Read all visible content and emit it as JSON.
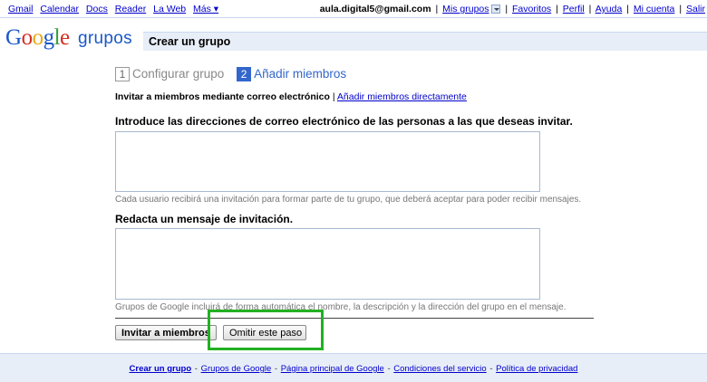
{
  "topbar": {
    "nav": [
      "Gmail",
      "Calendar",
      "Docs",
      "Reader",
      "La Web",
      "Más ▾"
    ],
    "email": "aula.digital5@gmail.com",
    "mis_grupos": "Mis grupos",
    "links": [
      "Favoritos",
      "Perfil",
      "Ayuda",
      "Mi cuenta",
      "Salir"
    ],
    "sep": "|"
  },
  "logo": {
    "letters": [
      "G",
      "o",
      "o",
      "g",
      "l",
      "e"
    ],
    "product": "grupos"
  },
  "page_title": "Crear un grupo",
  "steps": [
    {
      "num": "1",
      "label": "Configurar grupo"
    },
    {
      "num": "2",
      "label": "Añadir miembros"
    }
  ],
  "invite_mode": {
    "current": "Invitar a miembros mediante correo electrónico",
    "sep": "|",
    "alt_link": "Añadir miembros directamente"
  },
  "emails_section": {
    "label": "Introduce las direcciones de correo electrónico de las personas a las que deseas invitar.",
    "value": "",
    "hint": "Cada usuario recibirá una invitación para formar parte de tu grupo, que deberá aceptar para poder recibir mensajes."
  },
  "message_section": {
    "label": "Redacta un mensaje de invitación.",
    "value": "",
    "hint": "Grupos de Google incluirá de forma automática el nombre, la descripción y la dirección del grupo en el mensaje."
  },
  "buttons": {
    "invite": "Invitar a miembros",
    "skip": "Omitir este paso"
  },
  "footer": {
    "links": [
      "Crear un grupo",
      "Grupos de Google",
      "Página principal de Google",
      "Condiciones del servicio",
      "Política de privacidad"
    ],
    "sep": "-"
  },
  "colors": {
    "highlight": "#22b022",
    "link": "#0000cc",
    "bar_bg": "#e8eef7"
  }
}
